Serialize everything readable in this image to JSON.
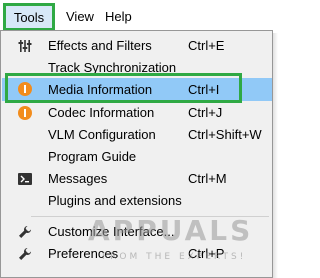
{
  "menubar": {
    "tools": "Tools",
    "view": "View",
    "help": "Help"
  },
  "menu": {
    "items": [
      {
        "label": "Effects and Filters",
        "shortcut": "Ctrl+E",
        "icon": "sliders-icon"
      },
      {
        "label": "Track Synchronization",
        "shortcut": "",
        "icon": ""
      },
      {
        "label": "Media Information",
        "shortcut": "Ctrl+I",
        "icon": "info-icon"
      },
      {
        "label": "Codec Information",
        "shortcut": "Ctrl+J",
        "icon": "info-icon"
      },
      {
        "label": "VLM Configuration",
        "shortcut": "Ctrl+Shift+W",
        "icon": ""
      },
      {
        "label": "Program Guide",
        "shortcut": "",
        "icon": ""
      },
      {
        "label": "Messages",
        "shortcut": "Ctrl+M",
        "icon": "terminal-icon"
      },
      {
        "label": "Plugins and extensions",
        "shortcut": "",
        "icon": ""
      },
      {
        "label": "Customize Interface...",
        "shortcut": "",
        "icon": "wrench-icon"
      },
      {
        "label": "Preferences",
        "shortcut": "Ctrl+P",
        "icon": "wrench-icon"
      }
    ]
  },
  "watermark": {
    "logo": "APPUALS",
    "tagline": "FROM THE EXPERTS!"
  },
  "colors": {
    "highlight": "#91c9f7",
    "annotation_outline": "#2fa944",
    "info_icon": "#f28c1c",
    "menu_background": "#f0f0f0"
  }
}
